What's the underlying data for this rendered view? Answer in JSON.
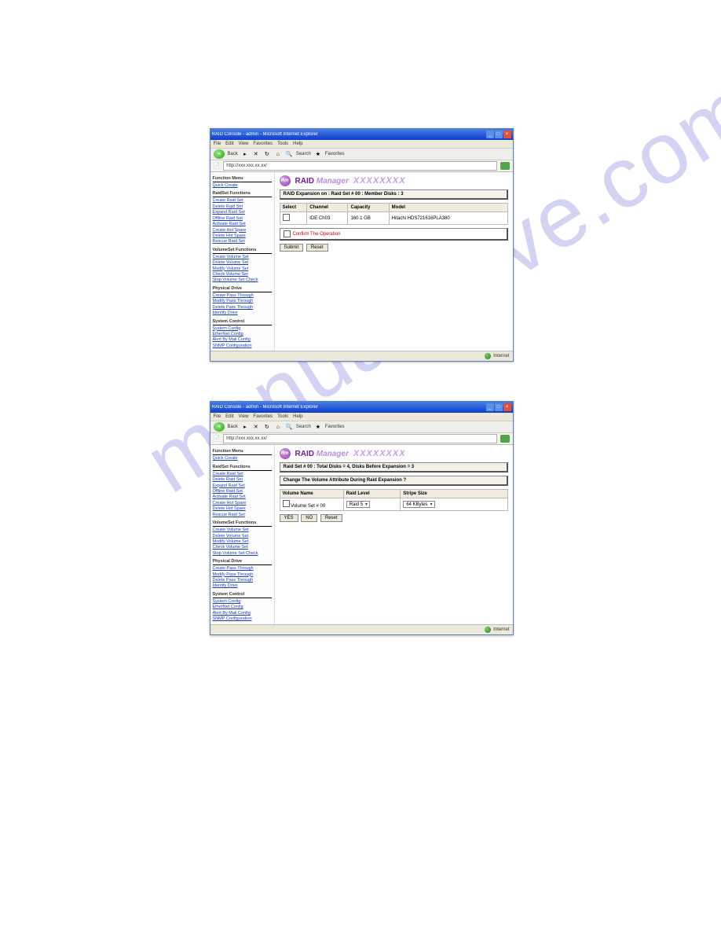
{
  "watermark_text": "manualshive.com",
  "screenshot1": {
    "window_title": "RAID Console - admin - Microsoft Internet Explorer",
    "menu": [
      "File",
      "Edit",
      "View",
      "Favorites",
      "Tools",
      "Help"
    ],
    "toolbar": {
      "back": "Back",
      "search": "Search",
      "favorites": "Favorites"
    },
    "address_url": "http://xxx.xxx.xx.xx/",
    "logo_text": "Rm",
    "brand1": "RAID",
    "brand2": "Manager",
    "xs": "XXXXXXXX",
    "panel_title": "RAID Expansion on : Raid Set # 00 : Member Disks : 3",
    "table": {
      "headers": [
        "Select",
        "Channel",
        "Capacity",
        "Model"
      ],
      "row": {
        "select": "",
        "channel": "IDE Ch03",
        "capacity": "160.1 GB",
        "model": "Hitachi HDS721616PLA380"
      }
    },
    "confirm_label": "Confirm The Operation",
    "submit_label": "Submit",
    "reset_label": "Reset",
    "status_right": "Internet",
    "sidebar": {
      "sec1_title": "Function Menu",
      "sec1_links": [
        "Quick Create"
      ],
      "sec2_title": "RaidSet Functions",
      "sec2_links": [
        "Create Raid Set",
        "Delete Raid Set",
        "Expand Raid Set",
        "Offline Raid Set",
        "Activate Raid Set",
        "Create Hot Spare",
        "Delete Hot Spare",
        "Rescue Raid Set"
      ],
      "sec3_title": "VolumeSet Functions",
      "sec3_links": [
        "Create Volume Set",
        "Delete Volume Set",
        "Modify Volume Set",
        "Check Volume Set",
        "Stop Volume Set Check"
      ],
      "sec4_title": "Physical Drive",
      "sec4_links": [
        "Create Pass Through",
        "Modify Pass Through",
        "Delete Pass Through",
        "Identify Drive"
      ],
      "sec5_title": "System Control",
      "sec5_links": [
        "System Config",
        "EtherNet Config",
        "Alert By Mail Config",
        "SNMP Configuration"
      ]
    }
  },
  "screenshot2": {
    "window_title": "RAID Console - admin - Microsoft Internet Explorer",
    "menu": [
      "File",
      "Edit",
      "View",
      "Favorites",
      "Tools",
      "Help"
    ],
    "toolbar": {
      "back": "Back",
      "search": "Search",
      "favorites": "Favorites"
    },
    "address_url": "http://xxx.xxx.xx.xx/",
    "logo_text": "Rm",
    "brand1": "RAID",
    "brand2": "Manager",
    "xs": "XXXXXXXX",
    "panel_title1": "Raid Set # 00 : Total Disks = 4, Disks Before Expansion = 3",
    "panel_title2": "Change The Volume Attribute During Raid Expansion ?",
    "table": {
      "headers": [
        "Volume Name",
        "Raid Level",
        "Stripe Size"
      ],
      "row": {
        "name": "Volume Set # 00",
        "level": "Raid 5",
        "stripe": "64   KBytes"
      }
    },
    "btn_yes": "YES",
    "btn_no": "NO",
    "btn_reset": "Reset",
    "status_right": "Internet",
    "sidebar": {
      "sec1_title": "Function Menu",
      "sec1_links": [
        "Quick Create"
      ],
      "sec2_title": "RaidSet Functions",
      "sec2_links": [
        "Create Raid Set",
        "Delete Raid Set",
        "Expand Raid Set",
        "Offline Raid Set",
        "Activate Raid Set",
        "Create Hot Spare",
        "Delete Hot Spare",
        "Rescue Raid Set"
      ],
      "sec3_title": "VolumeSet Functions",
      "sec3_links": [
        "Create Volume Set",
        "Delete Volume Set",
        "Modify Volume Set",
        "Check Volume Set",
        "Stop Volume Set Check"
      ],
      "sec4_title": "Physical Drive",
      "sec4_links": [
        "Create Pass Through",
        "Modify Pass Through",
        "Delete Pass Through",
        "Identify Drive"
      ],
      "sec5_title": "System Control",
      "sec5_links": [
        "System Config",
        "EtherNet Config",
        "Alert By Mail Config",
        "SNMP Configuration"
      ]
    }
  }
}
